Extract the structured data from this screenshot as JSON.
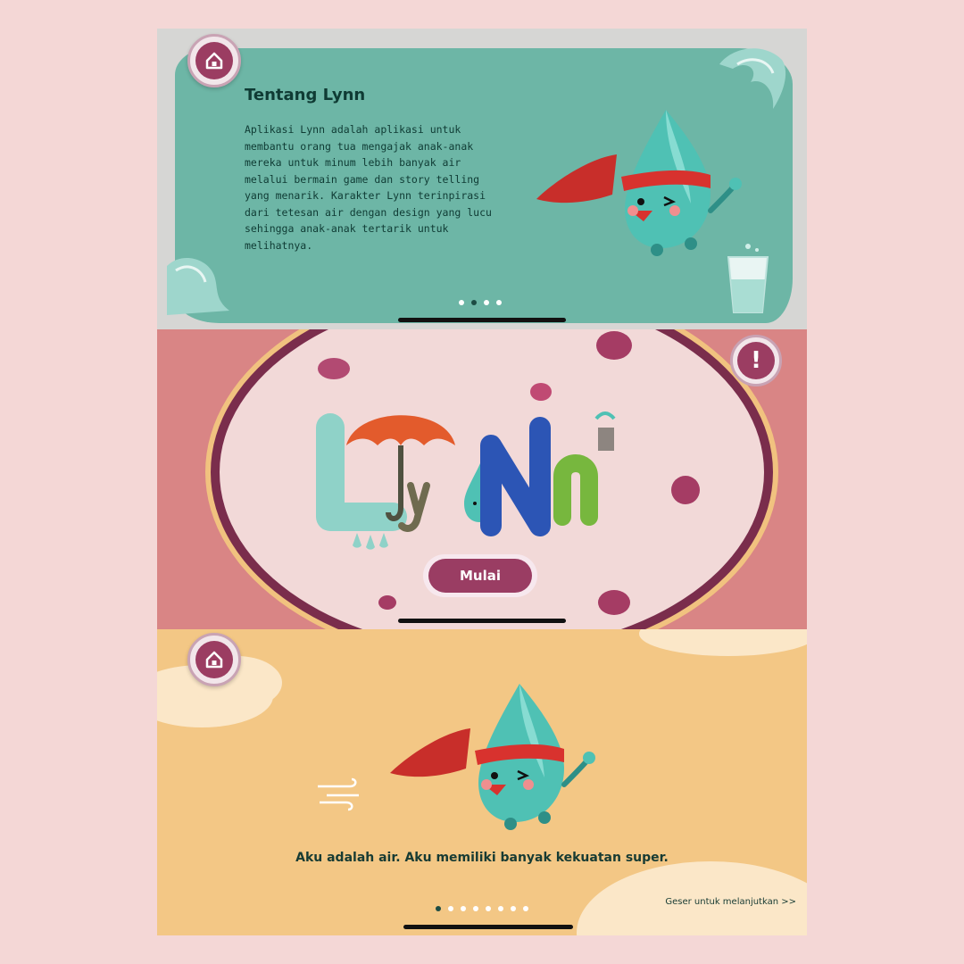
{
  "about": {
    "title": "Tentang Lynn",
    "body": "Aplikasi Lynn adalah aplikasi untuk membantu orang tua mengajak anak-anak mereka untuk minum lebih banyak air melalui bermain game dan story telling yang menarik. Karakter Lynn terinpirasi dari tetesan air dengan design yang lucu sehingga anak-anak tertarik untuk melihatnya.",
    "home_icon": "home-icon",
    "page_dots_total": 4,
    "page_dots_active": 1
  },
  "start": {
    "logo_text": "Lynn",
    "start_label": "Mulai",
    "info_icon": "info-icon",
    "info_glyph": "!"
  },
  "story": {
    "caption": "Aku adalah air. Aku memiliki banyak kekuatan super.",
    "swipe_label": "Geser untuk melanjutkan >>",
    "home_icon": "home-icon",
    "page_dots_total": 8,
    "page_dots_active": 0
  },
  "colors": {
    "background": "#f4d7d6",
    "teal": "#6db6a6",
    "plum": "#9b3d62",
    "peach": "#f3c785",
    "salmon": "#d98585"
  }
}
